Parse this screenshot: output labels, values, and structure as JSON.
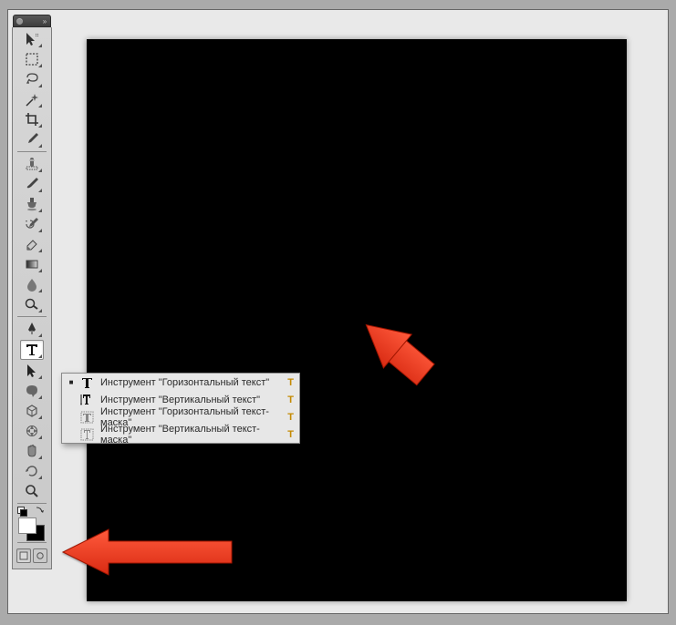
{
  "tools": [
    {
      "name": "move-tool"
    },
    {
      "name": "marquee-tool"
    },
    {
      "name": "lasso-tool"
    },
    {
      "name": "magic-wand-tool"
    },
    {
      "name": "crop-tool"
    },
    {
      "name": "eyedropper-tool"
    },
    {
      "name": "spot-healing-tool"
    },
    {
      "name": "brush-tool"
    },
    {
      "name": "clone-stamp-tool"
    },
    {
      "name": "history-brush-tool"
    },
    {
      "name": "eraser-tool"
    },
    {
      "name": "gradient-tool"
    },
    {
      "name": "blur-tool"
    },
    {
      "name": "dodge-tool"
    },
    {
      "name": "pen-tool"
    },
    {
      "name": "type-tool",
      "selected": true
    },
    {
      "name": "path-selection-tool"
    },
    {
      "name": "shape-tool"
    },
    {
      "name": "3d-tool"
    },
    {
      "name": "3d-camera-tool"
    },
    {
      "name": "hand-tool"
    },
    {
      "name": "rotate-view-tool"
    },
    {
      "name": "zoom-tool"
    }
  ],
  "flyout": {
    "items": [
      {
        "label": "Инструмент \"Горизонтальный текст\"",
        "shortcut": "T",
        "active": true,
        "icon": "h-type-icon"
      },
      {
        "label": "Инструмент \"Вертикальный текст\"",
        "shortcut": "T",
        "active": false,
        "icon": "v-type-icon"
      },
      {
        "label": "Инструмент \"Горизонтальный текст-маска\"",
        "shortcut": "T",
        "active": false,
        "icon": "h-type-mask-icon"
      },
      {
        "label": "Инструмент \"Вертикальный текст-маска\"",
        "shortcut": "T",
        "active": false,
        "icon": "v-type-mask-icon"
      }
    ]
  }
}
